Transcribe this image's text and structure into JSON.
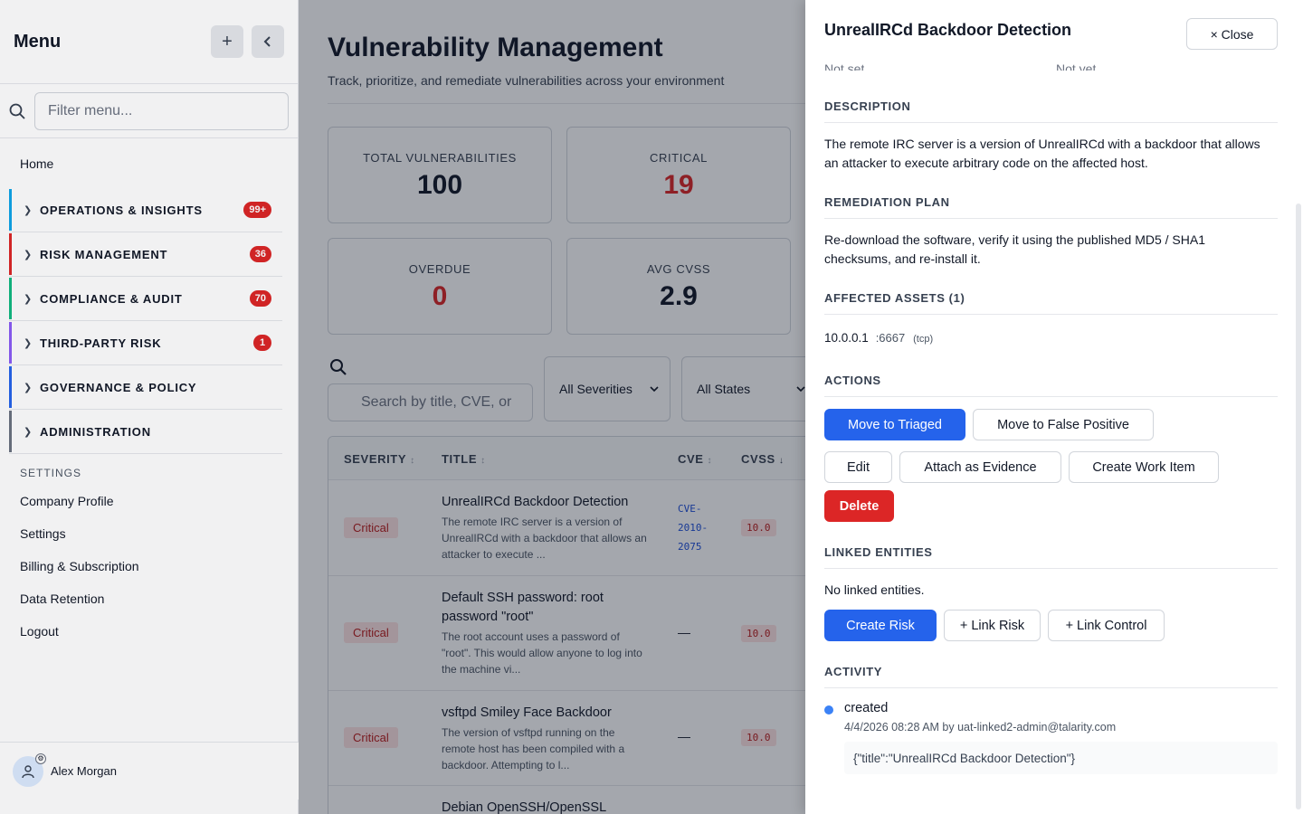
{
  "sidebar": {
    "title": "Menu",
    "add_icon": "plus-icon",
    "collapse_icon": "chevron-left-icon",
    "filter_placeholder": "Filter menu...",
    "home": "Home",
    "groups": [
      {
        "label": "OPERATIONS & INSIGHTS",
        "badge": "99+",
        "color": "#0ea5e9"
      },
      {
        "label": "RISK MANAGEMENT",
        "badge": "36",
        "color": "#dc2626"
      },
      {
        "label": "COMPLIANCE & AUDIT",
        "badge": "70",
        "color": "#10b981"
      },
      {
        "label": "THIRD-PARTY RISK",
        "badge": "1",
        "color": "#8b5cf6"
      },
      {
        "label": "GOVERNANCE & POLICY",
        "badge": "",
        "color": "#2563eb"
      },
      {
        "label": "ADMINISTRATION",
        "badge": "",
        "color": "#6b7280"
      }
    ],
    "settings_heading": "SETTINGS",
    "links": [
      "Company Profile",
      "Settings",
      "Billing & Subscription",
      "Data Retention",
      "Logout"
    ],
    "user_name": "Alex Morgan"
  },
  "main": {
    "title": "Vulnerability Management",
    "subtitle": "Track, prioritize, and remediate vulnerabilities across your environment",
    "stats": [
      {
        "label": "TOTAL VULNERABILITIES",
        "value": "100",
        "color": "#111827"
      },
      {
        "label": "CRITICAL",
        "value": "19",
        "color": "#dc2626"
      },
      {
        "label": "OVERDUE",
        "value": "0",
        "color": "#dc2626"
      },
      {
        "label": "AVG CVSS",
        "value": "2.9",
        "color": "#111827"
      }
    ],
    "search_placeholder": "Search by title, CVE, or",
    "severity_filter": "All Severities",
    "state_filter": "All States",
    "table": {
      "headers": {
        "severity": "SEVERITY",
        "title": "TITLE",
        "cve": "CVE",
        "cvss": "CVSS"
      },
      "rows": [
        {
          "severity": "Critical",
          "title": "UnrealIRCd Backdoor Detection",
          "desc": "The remote IRC server is a version of UnrealIRCd with a backdoor that allows an attacker to execute ...",
          "cve": [
            "CVE-",
            "2010-",
            "2075"
          ],
          "cvss": "10.0"
        },
        {
          "severity": "Critical",
          "title": "Default SSH password: root password \"root\"",
          "desc": "The root account uses a password of \"root\". This would allow anyone to log into the machine vi...",
          "cve": "—",
          "cvss": "10.0"
        },
        {
          "severity": "Critical",
          "title": "vsftpd Smiley Face Backdoor",
          "desc": "The version of vsftpd running on the remote host has been compiled with a backdoor. Attempting to l...",
          "cve": "—",
          "cvss": "10.0"
        },
        {
          "severity": "",
          "title": "Debian OpenSSH/OpenSSL",
          "desc": "",
          "cve": "",
          "cvss": ""
        }
      ]
    }
  },
  "panel": {
    "title": "UnrealIRCd Backdoor Detection",
    "close_label": "× Close",
    "cut_left": "Not set",
    "cut_right": "Not yet",
    "description_heading": "DESCRIPTION",
    "description": "The remote IRC server is a version of UnrealIRCd with a backdoor that allows an attacker to execute arbitrary code on the affected host.",
    "remediation_heading": "REMEDIATION PLAN",
    "remediation": "Re-download the software, verify it using the published MD5 / SHA1 checksums, and re-install it.",
    "assets_heading": "AFFECTED ASSETS (1)",
    "asset_ip": "10.0.0.1",
    "asset_port": ":6667",
    "asset_proto": "(tcp)",
    "actions_heading": "ACTIONS",
    "actions": {
      "triaged": "Move to Triaged",
      "false_positive": "Move to False Positive",
      "edit": "Edit",
      "evidence": "Attach as Evidence",
      "work_item": "Create Work Item",
      "delete": "Delete"
    },
    "linked_heading": "LINKED ENTITIES",
    "linked_empty": "No linked entities.",
    "linked_buttons": {
      "create_risk": "Create Risk",
      "link_risk": "+ Link Risk",
      "link_control": "+ Link Control"
    },
    "activity_heading": "ACTIVITY",
    "activity": {
      "event": "created",
      "meta": "4/4/2026 08:28 AM by uat-linked2-admin@talarity.com",
      "payload": "{\"title\":\"UnrealIRCd Backdoor Detection\"}"
    }
  }
}
